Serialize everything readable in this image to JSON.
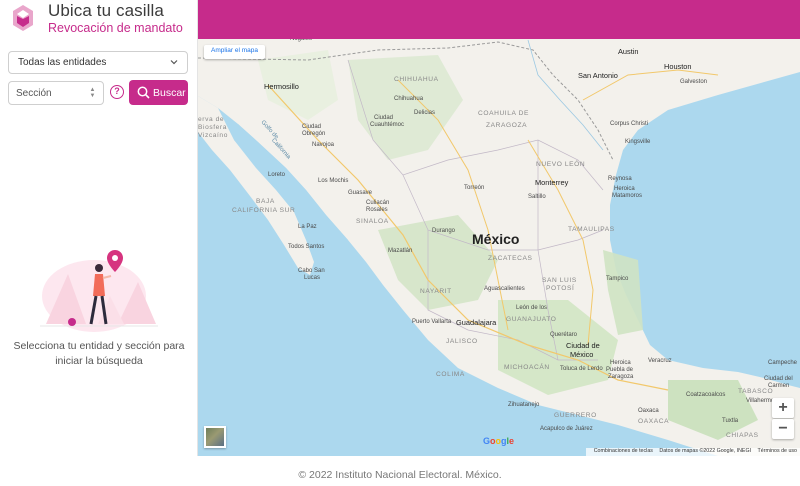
{
  "brand": {
    "title": "Ubica tu casilla",
    "subtitle": "Revocación de mandato",
    "logo_icon": "ine-logo-icon"
  },
  "colors": {
    "accent": "#c62b8b",
    "water": "#acd8ee",
    "land": "#f4f2ee"
  },
  "form": {
    "entidad_selected": "Todas las entidades",
    "seccion_placeholder": "Sección",
    "buscar_label": "Buscar"
  },
  "hint": {
    "line1": "Selecciona tu entidad y sección para",
    "line2": "iniciar la búsqueda"
  },
  "map": {
    "expand_label": "Ampliar el mapa",
    "zoom_in": "+",
    "zoom_out": "−",
    "country": "México",
    "attribution": {
      "shortcuts": "Combinaciones de teclas",
      "data": "Datos de mapas ©2022 Google, INEGI",
      "terms": "Términos de uso"
    },
    "labels": {
      "nogales": "Nogales",
      "chihuahua_state": "CHIHUAHUA",
      "austin": "Austin",
      "houston": "Houston",
      "san_antonio": "San Antonio",
      "galveston": "Galveston",
      "hermosillo": "Hermosillo",
      "chihuahua_city": "Chihuahua",
      "delicias": "Delicias",
      "coahuila": "COAHUILA DE",
      "zaragoza": "ZARAGOZA",
      "corpus": "Corpus Christi",
      "ciudad_obregon": "Ciudad",
      "obregon": "Obregón",
      "cuauhtemoc": "Ciudad",
      "cuauhtemoc2": "Cuauhtémoc",
      "navojoa": "Navojoa",
      "kingsville": "Kingsville",
      "nuevo_leon": "NUEVO LEÓN",
      "reynosa": "Reynosa",
      "heroica": "Heroica",
      "matamoros": "Matamoros",
      "biosfera": "erva de",
      "biosfera2": "Biosfera",
      "vizcaino": "Vizcaíno",
      "loreto": "Loreto",
      "los_mochis": "Los Mochis",
      "guasave": "Guasave",
      "torreon": "Torreón",
      "monterrey": "Monterrey",
      "saltillo": "Saltillo",
      "baja": "BAJA",
      "california_sur": "CALIFORNIA SUR",
      "culiacan": "Culiacán",
      "rosales": "Rosales",
      "la_paz": "La Paz",
      "sinaloa": "SINALOA",
      "durango_city": "Durango",
      "tamaulipas": "TAMAULIPAS",
      "todos_santos": "Todos Santos",
      "zacatecas": "ZACATECAS",
      "mazatlan": "Mazatlán",
      "cabo": "Cabo San",
      "lucas": "Lucas",
      "tampico": "Tampico",
      "nayarit": "NAYARIT",
      "san_luis": "SAN LUIS",
      "potosi": "POTOSÍ",
      "aguascalientes": "Aguascalientes",
      "puerto_vallarta": "Puerto Vallarta",
      "guadalajara": "Guadalajara",
      "guanajuato": "GUANAJUATO",
      "leon": "León de los",
      "jalisco": "JALISCO",
      "queretaro": "Querétaro",
      "cdmx": "Ciudad de",
      "cdmx2": "México",
      "veracruz": "Veracruz",
      "colima": "COLIMA",
      "michoacan": "MICHOACÁN",
      "toluca": "Toluca de Lerdo",
      "puebla": "Heroica",
      "puebla2": "Puebla de",
      "puebla3": "Zaragoza",
      "coatzacoalcos": "Coatzacoalcos",
      "ciudad_carmen": "Ciudad del",
      "carmen": "Carmen",
      "zihuatanejo": "Zihuatanejo",
      "guerrero": "GUERRERO",
      "oaxaca": "OAXACA",
      "villahermosa": "Villahermosa",
      "tabasco": "TABASCO",
      "acapulco": "Acapulco de Juárez",
      "oaxaca_city": "Oaxaca",
      "tuxtla": "Tuxtla",
      "chiapas": "CHIAPAS",
      "golfo": "Golfo de",
      "california_gulf": "California",
      "merida_ref": "Campeche"
    }
  },
  "footer": {
    "text": "© 2022 Instituto Nacional Electoral. México."
  }
}
